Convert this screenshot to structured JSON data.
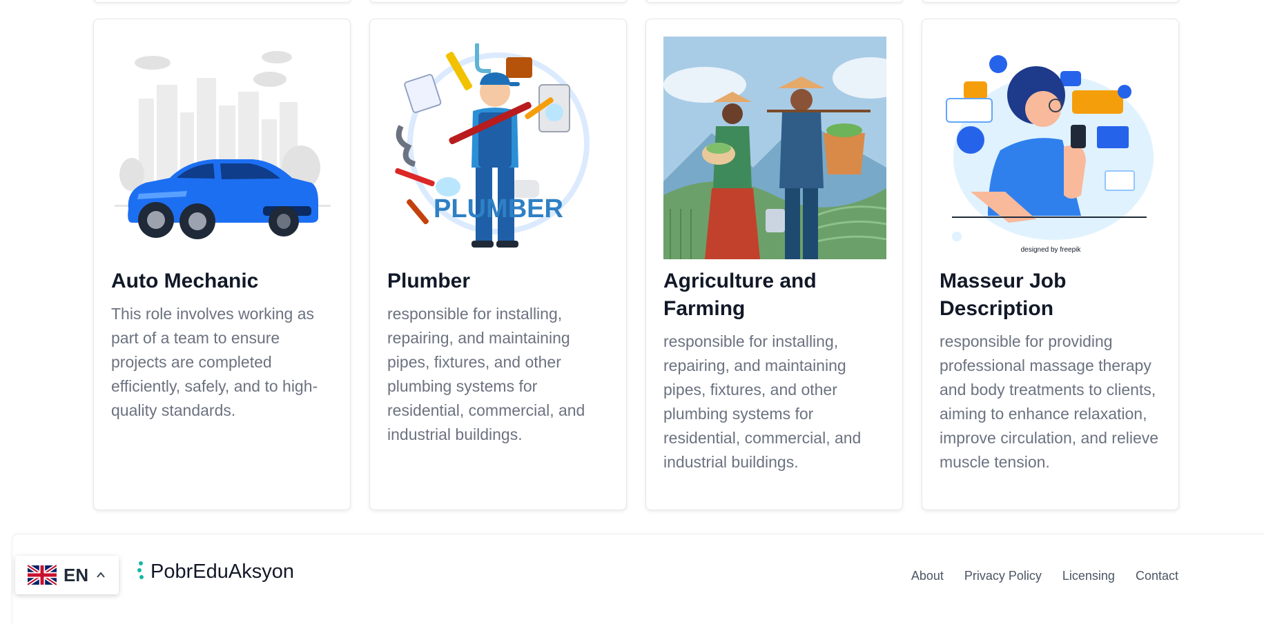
{
  "cards": [
    {
      "title": "Auto Mechanic",
      "description": "This role involves working as part of a team to ensure projects are completed efficiently, safely, and to high-quality standards.",
      "image_icon": "car-illustration"
    },
    {
      "title": "Plumber",
      "description": "responsible for installing, repairing, and maintaining pipes, fixtures, and other plumbing systems for residential, commercial, and industrial buildings.",
      "image_icon": "plumber-illustration",
      "image_caption": "PLUMBER"
    },
    {
      "title": "Agriculture and Farming",
      "description": "responsible for installing, repairing, and maintaining pipes, fixtures, and other plumbing systems for residential, commercial, and industrial buildings.",
      "image_icon": "farmers-illustration"
    },
    {
      "title": "Masseur Job Description",
      "description": "responsible for providing professional massage therapy and body treatments to clients, aiming to enhance relaxation, improve circulation, and relieve muscle tension.",
      "image_icon": "woman-phone-notifications-illustration",
      "image_credit": "designed by freepik"
    }
  ],
  "footer": {
    "brand": "PobrEduAksyon",
    "links": [
      "About",
      "Privacy Policy",
      "Licensing",
      "Contact"
    ]
  },
  "language": {
    "code": "EN",
    "flag_icon": "uk-flag-icon"
  },
  "colors": {
    "title": "#111827",
    "text": "#6b7280",
    "car_blue": "#1d6ff2",
    "brand_teal": "#14b8a6"
  }
}
